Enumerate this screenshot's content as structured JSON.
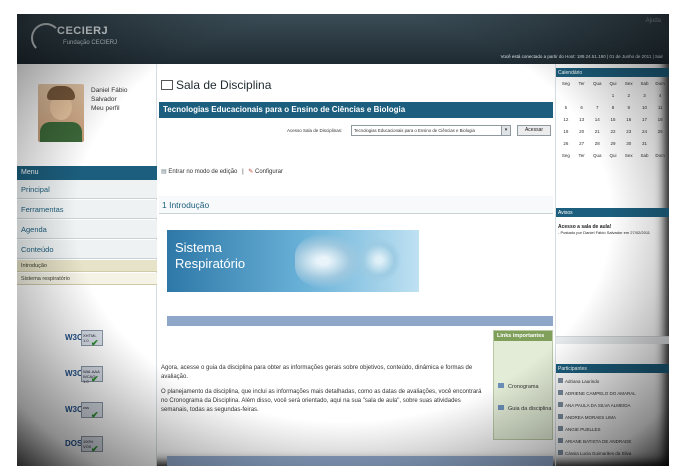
{
  "header": {
    "logo_title": "CECIERJ",
    "logo_subtitle": "Fundação CECIERJ",
    "corner_text": "Ajuda",
    "status": "Você está conectado a partir do Host: 189.24.51.190 | 01 de Junho de 2011 | Sair"
  },
  "user": {
    "name_line1": "Daniel Fábio",
    "name_line2": "Salvador",
    "profile_link": "Meu perfil"
  },
  "menu": {
    "header": "Menu",
    "items": [
      "Principal",
      "Ferramentas",
      "Agenda",
      "Conteúdo"
    ],
    "subitems": [
      "Introdução",
      "Sistema respiratório"
    ]
  },
  "badges": [
    {
      "w3": "W3C",
      "label": "XHTML 1.0"
    },
    {
      "w3": "W3C",
      "label": "WAI-AAA WCAG 1.0"
    },
    {
      "w3": "W3C",
      "label": "css"
    },
    {
      "w3": "DOS",
      "label": "100% VOX"
    }
  ],
  "main": {
    "page_title": "Sala de Disciplina",
    "course_title": "Tecnologias Educacionais para o Ensino de Ciências e Biologia",
    "access_label": "Acesso Sala de Disciplinas:",
    "access_value": "Tecnologias Educacionais para o Ensino de Ciências e Biologia",
    "access_button": "Acessar",
    "edit_mode": "Entrar no modo de edição",
    "separator": "|",
    "configure": "Configurar",
    "section_title": "1 Introdução",
    "banner_line1": "Sistema",
    "banner_line2": "Respiratório",
    "paragraph1": "Agora, acesse o guia da disciplina para obter as informações gerais sobre objetivos, conteúdo, dinâmica e formas de avaliação.",
    "paragraph2": "O planejamento da disciplina, que inclui as informações mais detalhadas, como as datas de avaliações, você encontrará no Cronograma da Disciplina. Além disso, você será orientado, aqui na sua \"sala de aula\", sobre suas atividades semanais, todas as segundas-feiras."
  },
  "links_box": {
    "title": "Links importantes",
    "items": [
      "Cronograma",
      "Guia da disciplina"
    ]
  },
  "sidebar": {
    "calendar_title": "Calendário",
    "weekdays": [
      "Seg",
      "Ter",
      "Qua",
      "Qui",
      "Sex",
      "Sab",
      "Dom"
    ],
    "weeks": [
      [
        "",
        "",
        "",
        "1",
        "2",
        "3",
        "4"
      ],
      [
        "5",
        "6",
        "7",
        "8",
        "9",
        "10",
        "11"
      ],
      [
        "12",
        "13",
        "14",
        "15",
        "16",
        "17",
        "18"
      ],
      [
        "19",
        "20",
        "21",
        "22",
        "23",
        "24",
        "25"
      ],
      [
        "26",
        "27",
        "28",
        "29",
        "30",
        "31",
        ""
      ]
    ],
    "notices_title": "Avisos",
    "notice_title": "Acesso a sala de aula!",
    "notice_meta": "- Postado por Daniel Fábio Salvador em 27/02/2011",
    "participants_title": "Participantes",
    "participants": [
      "Adriana Laurindo",
      "ADRIENE CAMPELO DO AMARAL",
      "ANA PAULA DA SILVA ALMEIDA",
      "ANDREA MORAES LIMA",
      "ANGIE PUELLES",
      "ARIANE BATISTA DE ANDRADE",
      "Cássia Lucia Guimarães da Silva"
    ]
  }
}
